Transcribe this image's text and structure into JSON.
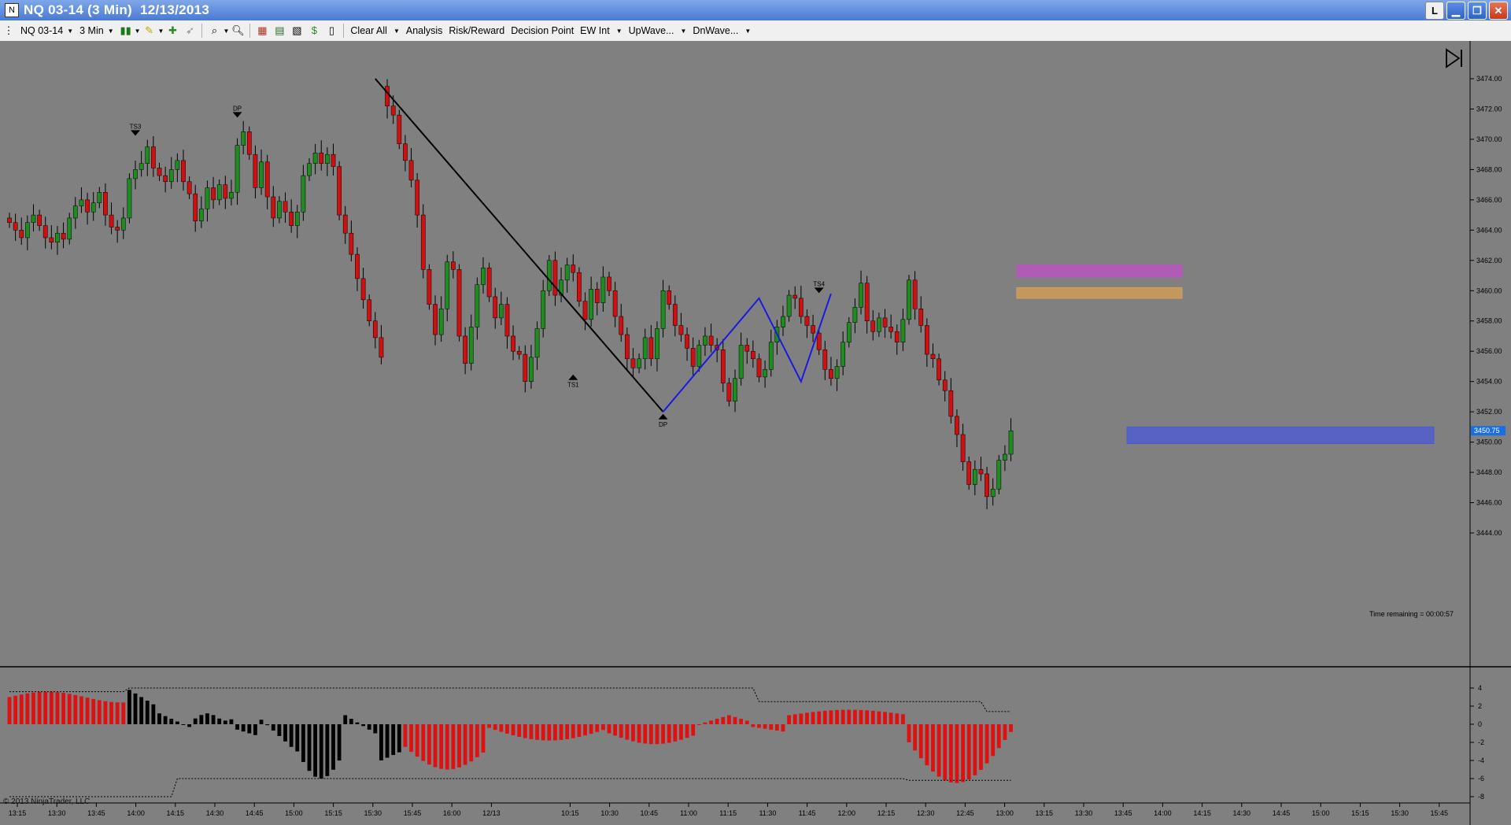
{
  "window": {
    "title": "NQ 03-14 (3 Min)  12/13/2013",
    "buttons": {
      "layout": "L",
      "minimize": "▁",
      "restore": "❐",
      "close": "✕"
    }
  },
  "toolbar": {
    "instrument": "NQ 03-14",
    "interval": "3 Min",
    "clear_all": "Clear All",
    "analysis": "Analysis",
    "risk_reward": "Risk/Reward",
    "decision_point": "Decision Point",
    "ew_int": "EW Int",
    "upwave": "UpWave...",
    "dnwave": "DnWave...",
    "icons": [
      "bars-icon",
      "pencil-icon",
      "crosshair-icon",
      "arrow-icon",
      "zoom-icon",
      "magnify-icon",
      "properties-icon",
      "indicators-icon",
      "strategies-icon",
      "data-box-icon",
      "s-icon",
      "window-icon"
    ]
  },
  "chart_data": {
    "type": "candlestick",
    "instrument": "NQ 03-14",
    "interval": "3 Min",
    "date": "12/13/2013",
    "price_axis": {
      "min": 3444,
      "max": 3474,
      "ticks": [
        "3474.00",
        "3472.00",
        "3470.00",
        "3468.00",
        "3466.00",
        "3464.00",
        "3462.00",
        "3460.00",
        "3458.00",
        "3456.00",
        "3454.00",
        "3452.00",
        "3450.00",
        "3448.00",
        "3446.00",
        "3444.00"
      ],
      "last_price": "3450.75"
    },
    "time_axis": [
      "13:15",
      "13:30",
      "13:45",
      "14:00",
      "14:15",
      "14:30",
      "14:45",
      "15:00",
      "15:15",
      "15:30",
      "15:45",
      "16:00",
      "12/13",
      "10:15",
      "10:30",
      "10:45",
      "11:00",
      "11:15",
      "11:30",
      "11:45",
      "12:00",
      "12:15",
      "12:30",
      "12:45",
      "13:00",
      "13:15",
      "13:30",
      "13:45",
      "14:00",
      "14:15",
      "14:30",
      "14:45",
      "15:00",
      "15:15",
      "15:30",
      "15:45"
    ],
    "bars_count": 166,
    "zigzag": [
      [
        3474,
        1
      ],
      [
        3452,
        0
      ]
    ],
    "markers": [
      {
        "label": "TS3",
        "dir": "down"
      },
      {
        "label": "DP",
        "dir": "down"
      },
      {
        "label": "TS1",
        "dir": "up"
      },
      {
        "label": "DP",
        "dir": "up"
      },
      {
        "label": "TS4",
        "dir": "down"
      }
    ],
    "zones": [
      {
        "name": "magenta-zone",
        "from": 3460.9,
        "to": 3461.7,
        "color": "#c050c8"
      },
      {
        "name": "orange-zone",
        "from": 3459.5,
        "to": 3460.2,
        "color": "#d8a050"
      },
      {
        "name": "blue-zone",
        "from": 3449.9,
        "to": 3451.0,
        "color": "#4a5ad8"
      }
    ],
    "time_remaining": "Time remaining = 00:00:57",
    "copyright": "© 2013 NinjaTrader, LLC",
    "oscillator": {
      "ticks": [
        "4",
        "2",
        "0",
        "-2",
        "-4",
        "-6",
        "-8"
      ],
      "min": -8.5,
      "max": 5
    }
  }
}
